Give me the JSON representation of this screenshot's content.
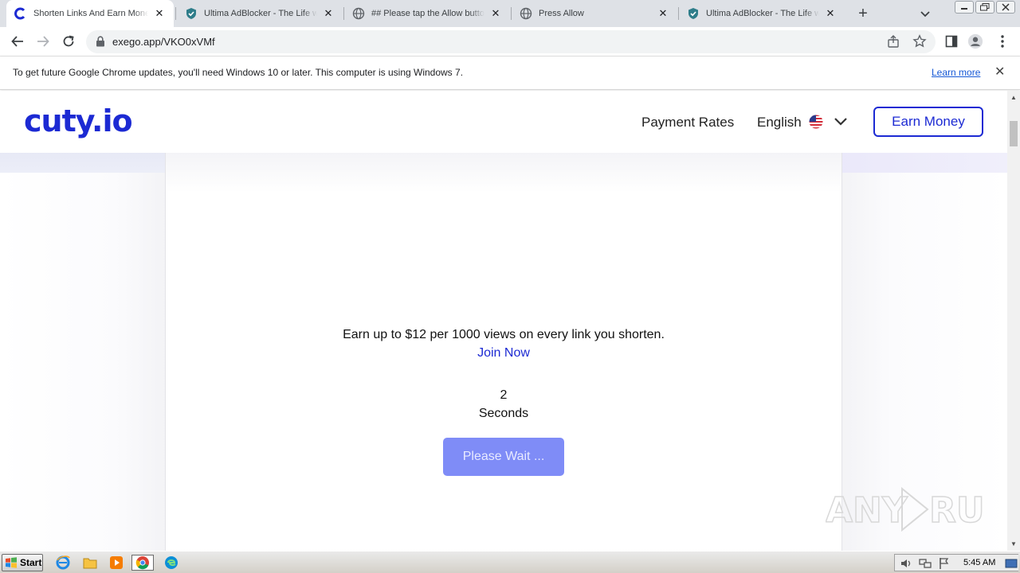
{
  "browser": {
    "tabs": [
      {
        "title": "Shorten Links And Earn Money",
        "icon": "cuty-c-icon",
        "active": true
      },
      {
        "title": "Ultima AdBlocker - The Life with",
        "icon": "shield-icon",
        "active": false
      },
      {
        "title": "## Please tap the Allow button",
        "icon": "globe-icon",
        "active": false
      },
      {
        "title": "Press Allow",
        "icon": "globe-icon",
        "active": false
      },
      {
        "title": "Ultima AdBlocker - The Life with",
        "icon": "shield-icon",
        "active": false
      }
    ],
    "url": "exego.app/VKO0xVMf"
  },
  "infobar": {
    "message": "To get future Google Chrome updates, you'll need Windows 10 or later. This computer is using Windows 7.",
    "link": "Learn more"
  },
  "site": {
    "logo": "cuty.io",
    "nav": {
      "rates": "Payment Rates",
      "language": "English",
      "earn_button": "Earn Money"
    },
    "promo": "Earn up to $12 per 1000 views on every link you shorten.",
    "join_link": "Join Now",
    "countdown_value": "2",
    "countdown_label": "Seconds",
    "wait_button": "Please Wait ..."
  },
  "watermark": "ANY RUN",
  "taskbar": {
    "start": "Start",
    "clock": "5:45 AM"
  },
  "colors": {
    "brand": "#1c2ad3",
    "wait_button": "#7f8cf7",
    "tabstrip": "#dee1e6"
  }
}
